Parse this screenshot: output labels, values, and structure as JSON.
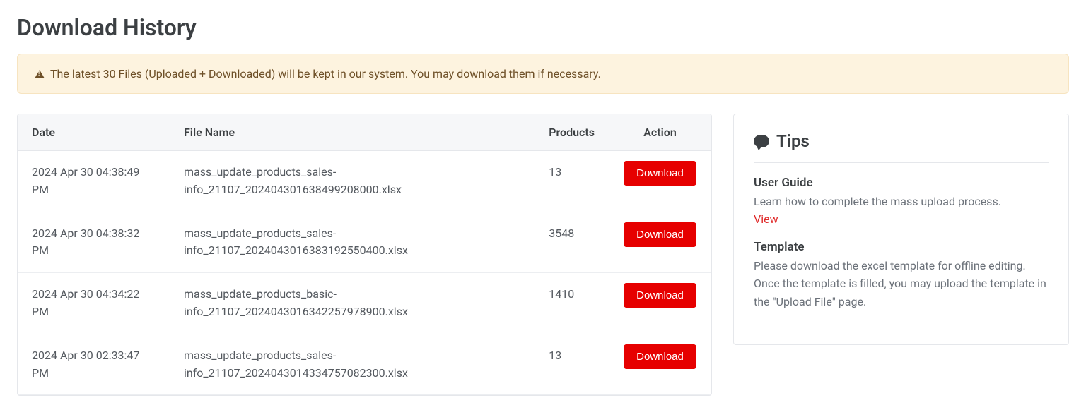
{
  "page": {
    "title": "Download History",
    "alert": "The latest 30 Files (Uploaded + Downloaded) will be kept in our system. You may download them if necessary."
  },
  "table": {
    "headers": {
      "date": "Date",
      "file": "File Name",
      "products": "Products",
      "action": "Action"
    },
    "action_label": "Download",
    "rows": [
      {
        "date": "2024 Apr 30 04:38:49 PM",
        "file": "mass_update_products_sales-info_21107_202404301638499208000.xlsx",
        "products": "13"
      },
      {
        "date": "2024 Apr 30 04:38:32 PM",
        "file": "mass_update_products_sales-info_21107_2024043016383192550400.xlsx",
        "products": "3548"
      },
      {
        "date": "2024 Apr 30 04:34:22 PM",
        "file": "mass_update_products_basic-info_21107_2024043016342257978900.xlsx",
        "products": "1410"
      },
      {
        "date": "2024 Apr 30 02:33:47 PM",
        "file": "mass_update_products_sales-info_21107_2024043014334757082300.xlsx",
        "products": "13"
      }
    ]
  },
  "tips": {
    "heading": "Tips",
    "guide": {
      "title": "User Guide",
      "desc": "Learn how to complete the mass upload process.",
      "link": "View"
    },
    "template": {
      "title": "Template",
      "desc": "Please download the excel template for offline editing. Once the template is filled, you may upload the template in the \"Upload File\" page."
    }
  }
}
